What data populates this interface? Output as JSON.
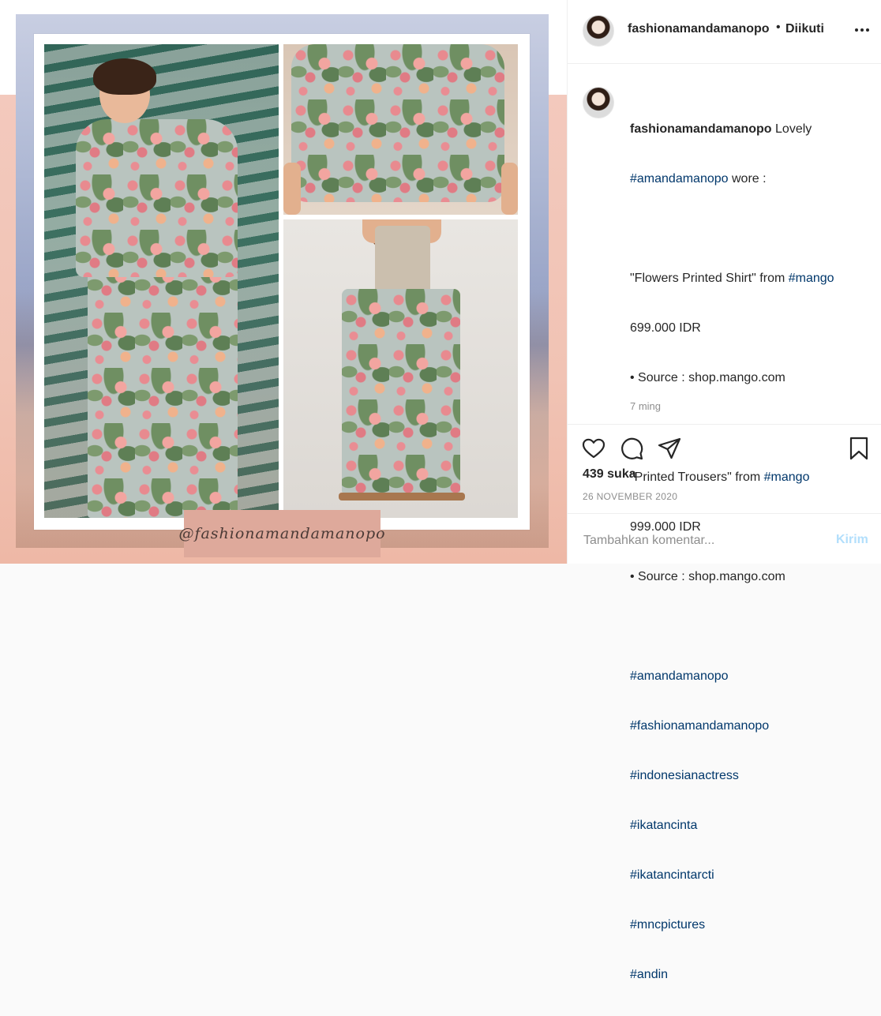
{
  "post": {
    "username": "fashionamandamanopo",
    "separator": "•",
    "follow_status": "Diikuti",
    "watermark": "@fashionamandamanopo",
    "image_icons": {
      "main_photo": "woman-floral-outfit-photo",
      "shirt_photo": "floral-shirt-product-photo",
      "pants_photo": "printed-trousers-product-photo"
    }
  },
  "caption": {
    "username": "fashionamandamanopo",
    "line1_text": " Lovely",
    "line2_tag": "#amandamanopo",
    "line2_text": " wore :",
    "item1_name": "\"Flowers Printed Shirt\" from ",
    "item1_tag": "#mango",
    "item1_price": "699.000 IDR",
    "item1_source": "• Source : shop.mango.com",
    "item2_name": "\"Printed Trousers\" from ",
    "item2_tag": "#mango",
    "item2_price": "999.000 IDR",
    "item2_source": "• Source : shop.mango.com",
    "hashtags": [
      "#amandamanopo",
      "#fashionamandamanopo",
      "#indonesianactress",
      "#ikatancinta",
      "#ikatancintarcti",
      "#mncpictures",
      "#andin"
    ],
    "time_ago": "7 ming"
  },
  "actions": {
    "icons": [
      "heart-icon",
      "comment-icon",
      "share-icon",
      "bookmark-icon"
    ]
  },
  "stats": {
    "likes": "439 suka",
    "date": "26 NOVEMBER 2020"
  },
  "comment": {
    "placeholder": "Tambahkan komentar...",
    "post_label": "Kirim"
  },
  "colors": {
    "link": "#00376b",
    "muted": "#8e8e8e",
    "post_button_disabled": "#b2dffc",
    "background_pink": "#f3c9bd"
  }
}
